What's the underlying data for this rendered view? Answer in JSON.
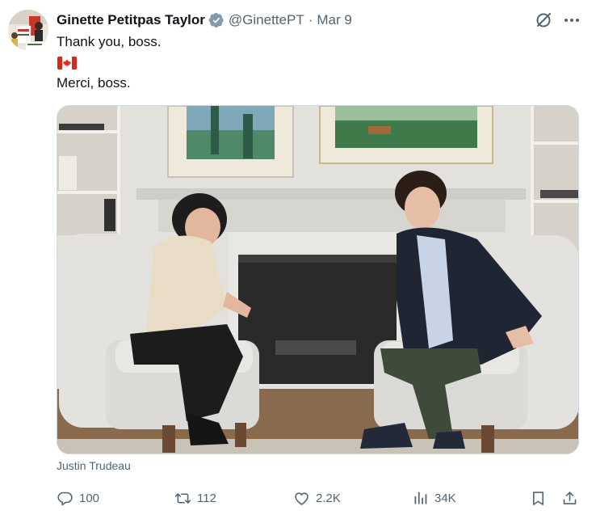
{
  "tweet": {
    "author": {
      "display_name": "Ginette Petitpas Taylor",
      "handle": "@GinettePT",
      "verified": true,
      "avatar_icon": "profile-photo"
    },
    "separator": "·",
    "date": "Mar 9",
    "text_lines": [
      "Thank you, boss.",
      "Merci, boss."
    ],
    "emoji": "canada-flag",
    "media": {
      "type": "photo",
      "caption": "Justin Trudeau"
    },
    "actions": {
      "replies": "100",
      "reposts": "112",
      "likes": "2.2K",
      "views": "34K"
    },
    "icons": {
      "grok": "grok-icon",
      "more": "more-icon",
      "reply": "reply-icon",
      "repost": "repost-icon",
      "like": "heart-icon",
      "views": "views-icon",
      "bookmark": "bookmark-icon",
      "share": "share-icon"
    },
    "colors": {
      "text": "#0f1419",
      "secondary": "#536471",
      "verified_badge": "#829aab",
      "border": "#cfd9de"
    }
  }
}
